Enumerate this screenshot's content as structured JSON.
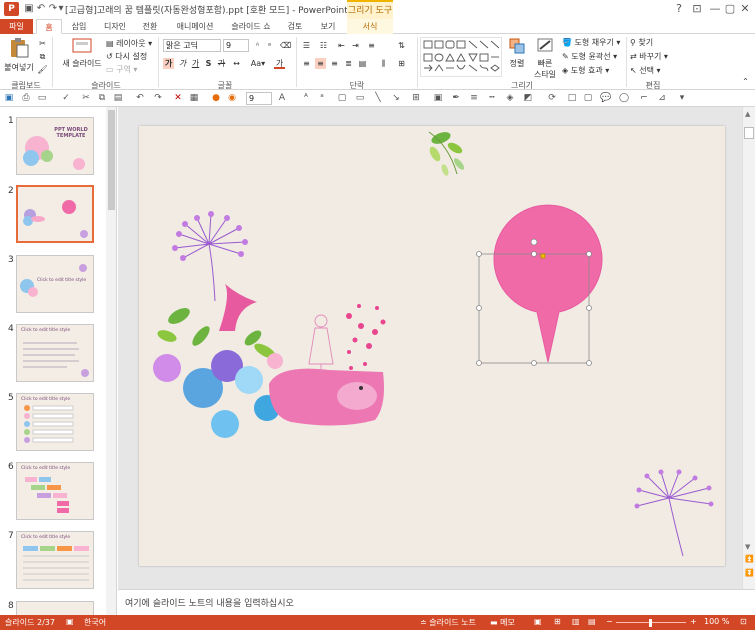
{
  "window": {
    "title": "[고급형]고래의 꿈 템플릿(자동완성형포함).ppt [호환 모드] - PowerPoint",
    "context_tab_title": "그리기 도구",
    "app_icon_letter": "P",
    "controls": [
      "?",
      "⊡",
      "—",
      "▢",
      "✕"
    ]
  },
  "quick_access": [
    "save-icon",
    "undo-icon",
    "redo-icon",
    "start-slideshow-icon",
    "customize-icon"
  ],
  "tabs": [
    "파일",
    "홈",
    "삽입",
    "디자인",
    "전환",
    "애니메이션",
    "슬라이드 쇼",
    "검토",
    "보기",
    "서식"
  ],
  "ribbon": {
    "clipboard": {
      "paste": "붙여넣기",
      "group": "클립보드"
    },
    "slides": {
      "new_slide": "새 슬라이드",
      "layout": "레이아웃",
      "reset": "다시 설정",
      "section": "구역",
      "group": "슬라이드"
    },
    "font": {
      "font_name": "맑은 고딕",
      "font_size": "9",
      "group": "글꼴"
    },
    "paragraph": {
      "group": "단락"
    },
    "drawing": {
      "arrange": "정렬",
      "quick_styles": "빠른",
      "quick_styles_2": "스타일",
      "fill": "도형 채우기",
      "outline": "도형 윤곽선",
      "effects": "도형 효과",
      "group": "그리기"
    },
    "editing": {
      "find": "찾기",
      "replace": "바꾸기",
      "select": "선택",
      "group": "편집"
    }
  },
  "mini_toolbar": {
    "font_size": "9"
  },
  "thumbnails": [
    {
      "num": "1",
      "title": "PPT WORLD TEMPLATE"
    },
    {
      "num": "2",
      "title": ""
    },
    {
      "num": "3",
      "title": "Click to edit title style"
    },
    {
      "num": "4",
      "title": "Click to edit title style"
    },
    {
      "num": "5",
      "title": "Click to edit title style"
    },
    {
      "num": "6",
      "title": "Click to edit title style"
    },
    {
      "num": "7",
      "title": "Click to edit title style"
    },
    {
      "num": "8",
      "title": ""
    }
  ],
  "selected_slide": 2,
  "notes_placeholder": "여기에 슬라이드 노트의 내용을 입력하십시오",
  "status": {
    "slide_pos": "슬라이드 2/37",
    "language": "한국어",
    "notes_btn": "슬라이드 노트",
    "comments_btn": "메모",
    "zoom": "100 %"
  },
  "colors": {
    "accent": "#d24726",
    "pink_shape": "#f06aa8",
    "slide_bg": "#f1ebe3"
  }
}
